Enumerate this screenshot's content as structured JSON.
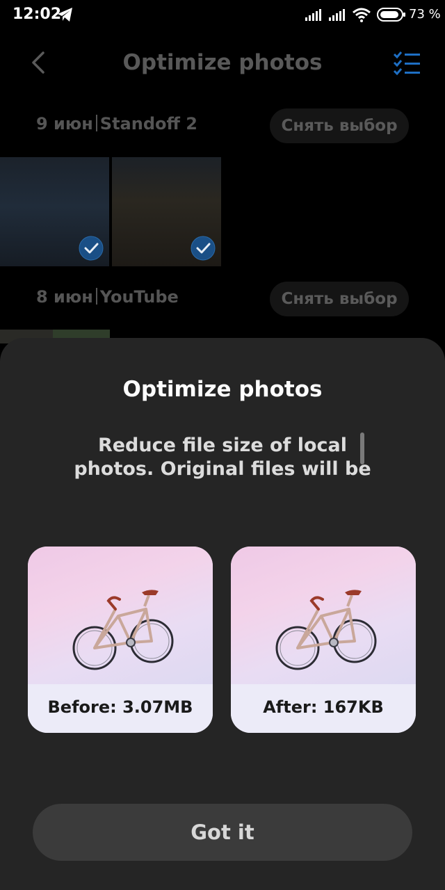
{
  "status_bar": {
    "time": "12:02",
    "battery_percent": "73 %",
    "icons": [
      "telegram-icon",
      "signal-icon",
      "signal-icon",
      "wifi-icon",
      "battery-icon"
    ]
  },
  "header": {
    "title": "Optimize photos",
    "back_icon": "chevron-left-icon",
    "action_icon": "select-all-icon",
    "accent_color": "#1e6fc4"
  },
  "groups": [
    {
      "date": "9 июн",
      "source": "Standoff 2",
      "deselect_label": "Снять выбор"
    },
    {
      "date": "8 июн",
      "source": "YouTube",
      "deselect_label": "Снять выбор"
    }
  ],
  "sheet": {
    "title": "Optimize photos",
    "description": "Reduce file size of local photos. Original files will be",
    "before_label": "Before:  3.07MB",
    "after_label": "After:  167KB",
    "button_label": "Got it"
  }
}
